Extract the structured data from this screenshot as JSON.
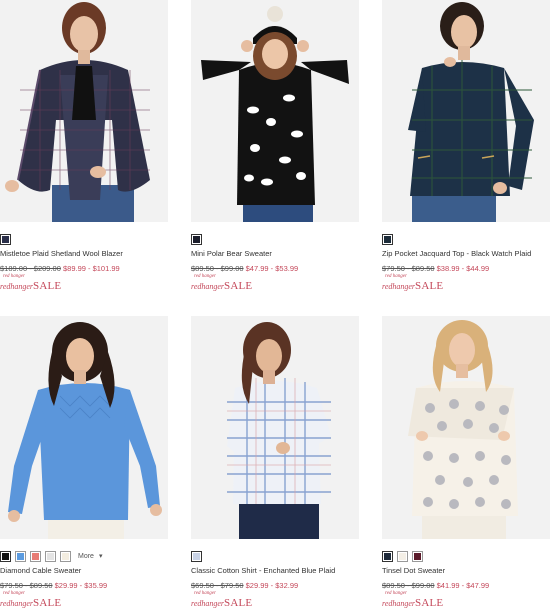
{
  "products": [
    {
      "name": "Mistletoe Plaid Shetland Wool Blazer",
      "orig_price": "$189.00 - $209.00",
      "sale_price": "$89.99 - $101.99",
      "swatches": [
        "#2b2f4a"
      ],
      "promo": {
        "small": "red hanger",
        "red": "red",
        "hanger": "hanger",
        "sale": "SALE"
      }
    },
    {
      "name": "Mini Polar Bear Sweater",
      "orig_price": "$89.50 - $99.00",
      "sale_price": "$47.99 - $53.99",
      "swatches": [
        "#1a1d2b"
      ],
      "promo": {
        "small": "red hanger",
        "red": "red",
        "hanger": "hanger",
        "sale": "SALE"
      }
    },
    {
      "name": "Zip Pocket Jacquard Top - Black Watch Plaid",
      "orig_price": "$79.50 - $89.50",
      "sale_price": "$38.99 - $44.99",
      "swatches": [
        "#1c2c3a"
      ],
      "promo": {
        "small": "red hanger",
        "red": "red",
        "hanger": "hanger",
        "sale": "SALE"
      }
    },
    {
      "name": "Diamond Cable Sweater",
      "orig_price": "$79.50 - $89.50",
      "sale_price": "$29.99 - $35.99",
      "swatches": [
        "#111111",
        "#5b9be0",
        "#e77c74",
        "#e4e4e4",
        "#f3ede0"
      ],
      "more_label": "More",
      "promo": {
        "small": "red hanger",
        "red": "red",
        "hanger": "hanger",
        "sale": "SALE"
      }
    },
    {
      "name": "Classic Cotton Shirt - Enchanted Blue Plaid",
      "orig_price": "$69.50 - $79.50",
      "sale_price": "$29.99 - $32.99",
      "swatches": [
        "#c9d3e6"
      ],
      "promo": {
        "small": "red hanger",
        "red": "red",
        "hanger": "hanger",
        "sale": "SALE"
      }
    },
    {
      "name": "Tinsel Dot Sweater",
      "orig_price": "$89.50 - $99.00",
      "sale_price": "$41.99 - $47.99",
      "swatches": [
        "#1e2a3a",
        "#f4efe6",
        "#5a1a2a"
      ],
      "promo": {
        "small": "red hanger",
        "red": "red",
        "hanger": "hanger",
        "sale": "SALE"
      }
    }
  ]
}
